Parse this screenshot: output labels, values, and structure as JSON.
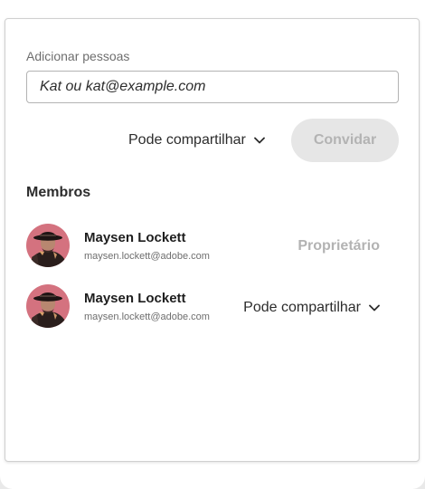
{
  "add_people": {
    "label": "Adicionar pessoas",
    "input_value": "",
    "placeholder": "Kat ou kat@example.com"
  },
  "invite": {
    "permission_value": "Pode compartilhar",
    "button_label": "Convidar",
    "button_state": "disabled"
  },
  "members": {
    "heading": "Membros",
    "items": [
      {
        "name": "Maysen Lockett",
        "email": "maysen.lockett@adobe.com",
        "role": "Proprietário"
      },
      {
        "name": "Maysen Lockett",
        "email": "maysen.lockett@adobe.com",
        "permission": "Pode compartilhar"
      }
    ]
  },
  "icons": {
    "dropdown": "chevron-down-icon",
    "avatar": "user-photo"
  },
  "colors": {
    "text": "#2c2c2c",
    "muted_text": "#6e6e6e",
    "disabled_text": "#b3b3b3",
    "disabled_button_bg": "#e6e6e6",
    "input_border": "#b3b3b3",
    "avatar_bg": "#d4727f"
  }
}
